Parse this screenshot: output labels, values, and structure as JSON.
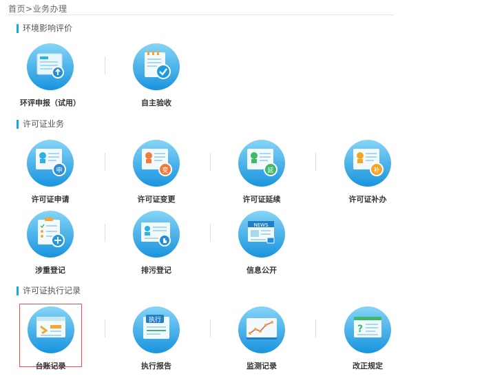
{
  "breadcrumb": {
    "home": "首页",
    "separator": ">",
    "current": "业务办理"
  },
  "sections": [
    {
      "title": "环境影响评价",
      "items": [
        {
          "label": "环评申报（试用）",
          "icon": "document-upload-icon"
        },
        {
          "label": "自主验收",
          "icon": "checklist-check-icon"
        }
      ]
    },
    {
      "title": "许可证业务",
      "items": [
        {
          "label": "许可证申请",
          "icon": "license-apply-icon",
          "badge": "申",
          "badge_color": "#2d8fd8"
        },
        {
          "label": "许可证变更",
          "icon": "license-change-icon",
          "badge": "变",
          "badge_color": "#f07b3c"
        },
        {
          "label": "许可证延续",
          "icon": "license-extend-icon",
          "badge": "延",
          "badge_color": "#3fb86a"
        },
        {
          "label": "许可证补办",
          "icon": "license-reissue-icon",
          "badge": "补",
          "badge_color": "#f5a623"
        },
        {
          "label": "涉重登记",
          "icon": "register-checklist-icon"
        },
        {
          "label": "排污登记",
          "icon": "discharge-register-icon"
        },
        {
          "label": "信息公开",
          "icon": "news-icon",
          "badge": "NEWS"
        }
      ]
    },
    {
      "title": "许可证执行记录",
      "items": [
        {
          "label": "台账记录",
          "icon": "ledger-icon",
          "selected": true
        },
        {
          "label": "执行报告",
          "icon": "execution-report-icon",
          "badge": "执行"
        },
        {
          "label": "监测记录",
          "icon": "monitor-chart-icon"
        },
        {
          "label": "改正规定",
          "icon": "correction-question-icon",
          "badge": "?"
        }
      ]
    }
  ],
  "colors": {
    "accent": "#1aa6e6",
    "circle_light": "#7fd0f5",
    "circle_dark": "#1a98e0",
    "selected_border": "#e05050"
  }
}
